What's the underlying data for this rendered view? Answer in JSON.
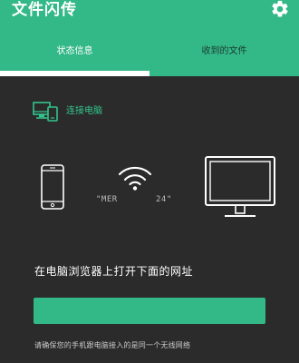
{
  "app": {
    "title": "文件闪传",
    "settings_icon": "gear-icon"
  },
  "tabs": [
    {
      "label": "状态信息",
      "active": true
    },
    {
      "label": "收到的文件",
      "active": false
    }
  ],
  "connect": {
    "label": "连接电脑",
    "icon": "computer-connect-icon"
  },
  "network": {
    "ssid_left": "\"MER",
    "ssid_right": "24\""
  },
  "instruction": "在电脑浏览器上打开下面的网址",
  "url_text": "",
  "footnote": "请确保您的手机跟电脑接入的是同一个无线网络",
  "colors": {
    "accent": "#33b887",
    "background": "#2b2b2b",
    "connect_text": "#33c48c"
  }
}
